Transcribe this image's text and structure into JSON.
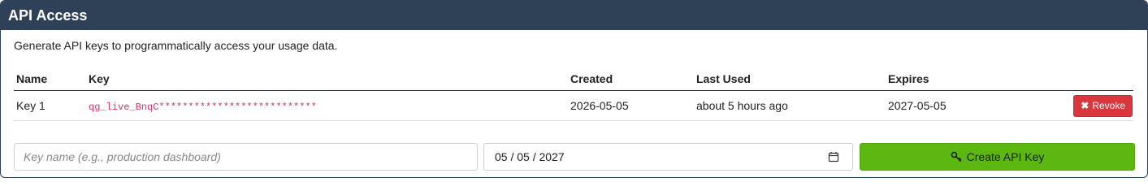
{
  "panel": {
    "title": "API Access",
    "description": "Generate API keys to programmatically access your usage data."
  },
  "table": {
    "headers": {
      "name": "Name",
      "key": "Key",
      "created": "Created",
      "last_used": "Last Used",
      "expires": "Expires"
    },
    "rows": [
      {
        "name": "Key 1",
        "key": "qg_live_BnqC***************************",
        "created": "2026-05-05",
        "last_used": "about 5 hours ago",
        "expires": "2027-05-05",
        "revoke_icon": "✖",
        "revoke_label": "Revoke"
      }
    ]
  },
  "form": {
    "name_placeholder": "Key name (e.g., production dashboard)",
    "expiry_date": "05 / 05 / 2027",
    "create_label": "Create API Key"
  },
  "colors": {
    "header": "#2e4157",
    "revoke": "#d9363e",
    "create": "#5cb811",
    "key_code": "#d6336c"
  },
  "icons": {
    "revoke": "close-icon",
    "date": "calendar-icon",
    "create": "key-icon"
  }
}
